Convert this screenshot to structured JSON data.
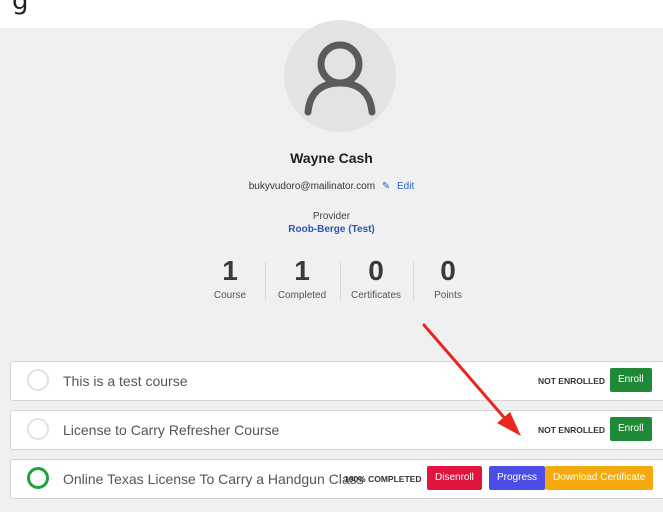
{
  "page": {
    "partial_heading": "g"
  },
  "profile": {
    "name": "Wayne Cash",
    "email": "bukyvudoro@mailinator.com",
    "edit_label": "Edit",
    "provider_label": "Provider",
    "provider_name": "Roob-Berge (Test)"
  },
  "stats": [
    {
      "value": "1",
      "label": "Course"
    },
    {
      "value": "1",
      "label": "Completed"
    },
    {
      "value": "0",
      "label": "Certificates"
    },
    {
      "value": "0",
      "label": "Points"
    }
  ],
  "courses": [
    {
      "title": "This is a test course",
      "status": "NOT ENROLLED",
      "action": "Enroll"
    },
    {
      "title": "License to Carry Refresher Course",
      "status": "NOT ENROLLED",
      "action": "Enroll"
    },
    {
      "title": "Online Texas License To Carry a Handgun Class",
      "status": "100% COMPLETED",
      "actions": [
        "Disenroll",
        "Progress",
        "Download Certificate"
      ]
    }
  ],
  "colors": {
    "accent_blue": "#2563c9",
    "enroll_green": "#1e8a35",
    "disenroll_red": "#e0143c",
    "progress_blue": "#4b4de6",
    "download_orange": "#f5a90c",
    "annotation_arrow": "#e8261e"
  }
}
